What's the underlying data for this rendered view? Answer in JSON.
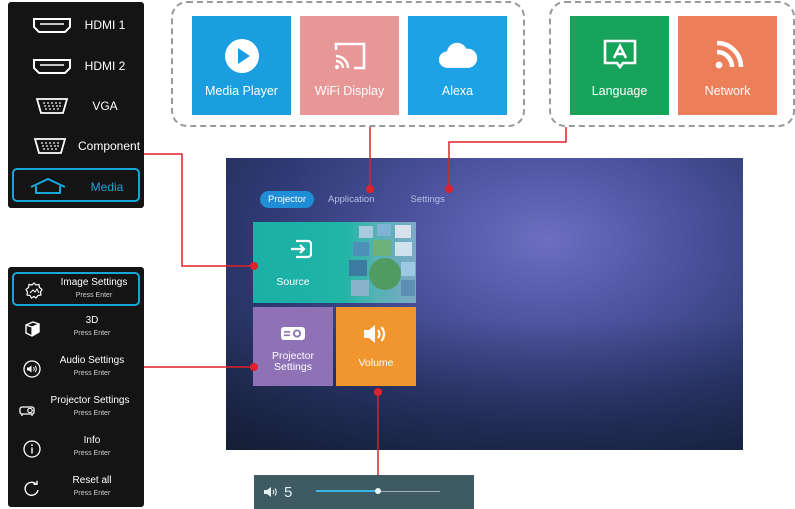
{
  "input_sources": {
    "items": [
      {
        "label": "HDMI 1",
        "icon": "hdmi-port-icon",
        "selected": false
      },
      {
        "label": "HDMI 2",
        "icon": "hdmi-port-icon",
        "selected": false
      },
      {
        "label": "VGA",
        "icon": "vga-port-icon",
        "selected": false
      },
      {
        "label": "Component",
        "icon": "component-port-icon",
        "selected": false
      },
      {
        "label": "Media",
        "icon": "home-icon",
        "selected": true
      }
    ]
  },
  "settings_menu": {
    "items": [
      {
        "title": "Image Settings",
        "hint": "Press Enter",
        "icon": "image-settings-icon",
        "selected": true
      },
      {
        "title": "3D",
        "hint": "Press Enter",
        "icon": "cube-3d-icon",
        "selected": false
      },
      {
        "title": "Audio Settings",
        "hint": "Press Enter",
        "icon": "speaker-icon",
        "selected": false
      },
      {
        "title": "Projector Settings",
        "hint": "Press Enter",
        "icon": "projector-icon",
        "selected": false
      },
      {
        "title": "Info",
        "hint": "Press Enter",
        "icon": "info-icon",
        "selected": false
      },
      {
        "title": "Reset all",
        "hint": "Press Enter",
        "icon": "reset-icon",
        "selected": false
      }
    ]
  },
  "application_group": {
    "tiles": [
      {
        "label": "Media Player",
        "icon": "play-icon",
        "color": "#1a9ee0"
      },
      {
        "label": "WiFi Display",
        "icon": "cast-icon",
        "color": "#e89797"
      },
      {
        "label": "Alexa",
        "icon": "cloud-icon",
        "color": "#1da2e6"
      }
    ]
  },
  "settings_group": {
    "tiles": [
      {
        "label": "Language",
        "icon": "language-icon",
        "color": "#18a35a"
      },
      {
        "label": "Network",
        "icon": "wifi-signal-icon",
        "color": "#ed7e5a"
      }
    ]
  },
  "home_screen": {
    "tabs": [
      {
        "label": "Projector",
        "active": true
      },
      {
        "label": "Application",
        "active": false
      },
      {
        "label": "Settings",
        "active": false
      }
    ],
    "tiles": {
      "source": {
        "label": "Source",
        "icon": "input-arrow-icon",
        "color": "#1ab0a6"
      },
      "projector_settings": {
        "label": "Projector\nSettings",
        "icon": "projector-icon",
        "color": "#8f72b6"
      },
      "volume": {
        "label": "Volume",
        "icon": "speaker-icon",
        "color": "#f0962e"
      }
    }
  },
  "volume_bar": {
    "icon": "speaker-icon",
    "value": "5",
    "level_fraction": 0.5
  },
  "colors": {
    "accent": "#19a6d8",
    "callout": "#e0202a",
    "panel_bg": "#141414"
  }
}
